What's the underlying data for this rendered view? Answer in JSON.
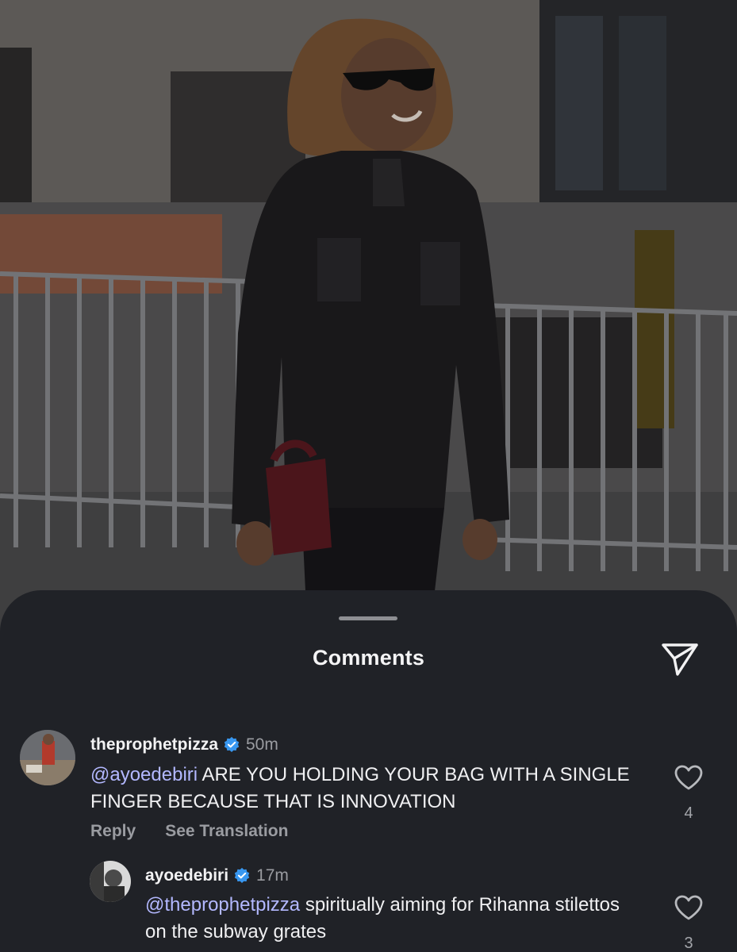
{
  "sheet": {
    "title": "Comments",
    "share_icon": "paper-plane-icon"
  },
  "comments": [
    {
      "username": "theprophetpizza",
      "verified": true,
      "time": "50m",
      "mention": "@ayoedebiri",
      "text": " ARE YOU HOLDING YOUR BAG WITH A SINGLE FINGER BECAUSE THAT IS INNOVATION",
      "reply_label": "Reply",
      "translate_label": "See Translation",
      "likes": "4"
    },
    {
      "username": "ayoedebiri",
      "verified": true,
      "time": "17m",
      "mention": "@theprophetpizza",
      "text": " spiritually aiming for Rihanna stilettos on the subway grates",
      "likes": "3"
    }
  ],
  "colors": {
    "sheet_bg": "#202227",
    "mention": "#b3b8ff",
    "verified_badge": "#3897f0",
    "muted_text": "#9a9ca1"
  }
}
